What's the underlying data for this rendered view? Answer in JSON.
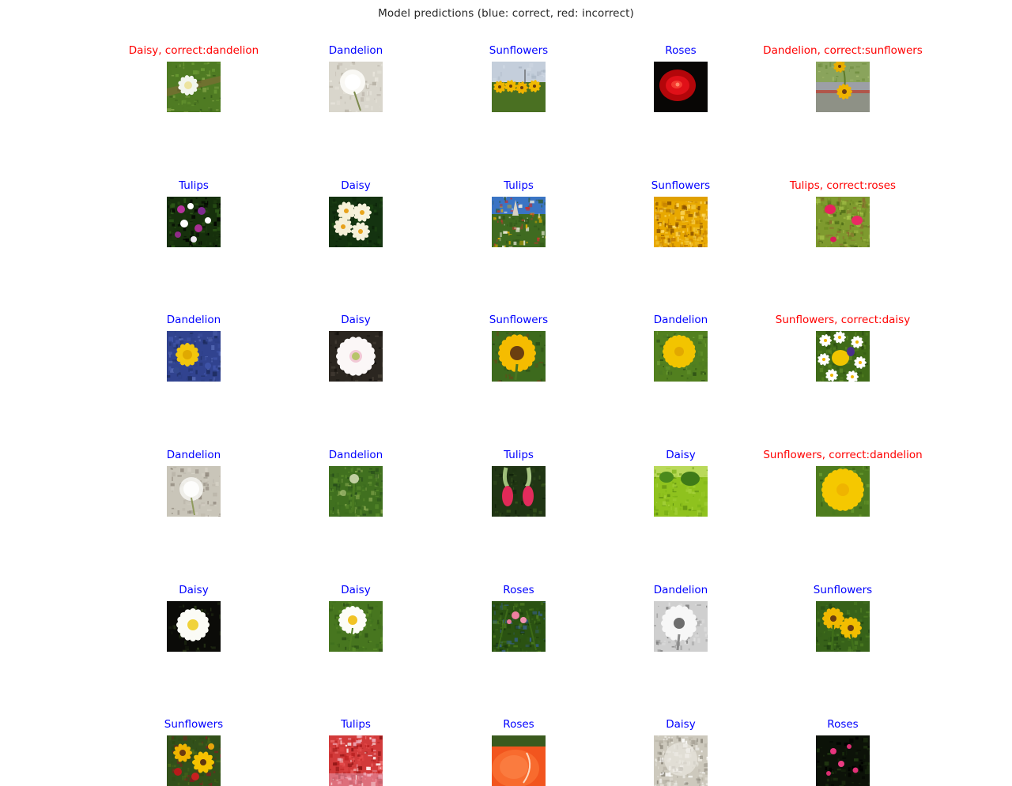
{
  "figure": {
    "title": "Model predictions (blue: correct, red: incorrect)",
    "colors": {
      "correct": "#0000ff",
      "incorrect": "#ff0000",
      "title_color": "#262626",
      "background": "#ffffff"
    },
    "grid": {
      "columns": 5,
      "label_rows": 6,
      "image_rows": 6
    }
  },
  "columns": [
    {
      "index": 0,
      "cells": [
        {
          "label": "Daisy, correct:dandelion",
          "status": "incorrect",
          "predicted": "Daisy",
          "actual": "dandelion",
          "image": "daisy-white-on-green-blur"
        },
        {
          "label": "Tulips",
          "status": "correct",
          "predicted": "Tulips",
          "actual": "tulips",
          "image": "purple-white-flower-cluster"
        },
        {
          "label": "Dandelion",
          "status": "correct",
          "predicted": "Dandelion",
          "actual": "dandelion",
          "image": "yellow-dandelion-in-bluebells"
        },
        {
          "label": "Dandelion",
          "status": "correct",
          "predicted": "Dandelion",
          "actual": "dandelion",
          "image": "dandelion-seedhead-grey"
        },
        {
          "label": "Daisy",
          "status": "correct",
          "predicted": "Daisy",
          "actual": "daisy",
          "image": "white-daisy-dark-background"
        },
        {
          "label": "Sunflowers",
          "status": "correct",
          "predicted": "Sunflowers",
          "actual": "sunflowers",
          "image": "sunflower-bouquet-mixed"
        }
      ]
    },
    {
      "index": 1,
      "cells": [
        {
          "label": "Dandelion",
          "status": "correct",
          "predicted": "Dandelion",
          "actual": "dandelion",
          "image": "dandelion-seedhead-white"
        },
        {
          "label": "Daisy",
          "status": "correct",
          "predicted": "Daisy",
          "actual": "daisy",
          "image": "cream-daisies-cluster"
        },
        {
          "label": "Daisy",
          "status": "correct",
          "predicted": "Daisy",
          "actual": "daisy",
          "image": "pink-white-daisy-closeup"
        },
        {
          "label": "Dandelion",
          "status": "correct",
          "predicted": "Dandelion",
          "actual": "dandelion",
          "image": "green-thistle-plant"
        },
        {
          "label": "Daisy",
          "status": "correct",
          "predicted": "Daisy",
          "actual": "daisy",
          "image": "white-daisy-yellow-center-field"
        },
        {
          "label": "Tulips",
          "status": "correct",
          "predicted": "Tulips",
          "actual": "tulips",
          "image": "red-tulip-field"
        }
      ]
    },
    {
      "index": 2,
      "cells": [
        {
          "label": "Sunflowers",
          "status": "correct",
          "predicted": "Sunflowers",
          "actual": "sunflowers",
          "image": "sunflower-field-horizon"
        },
        {
          "label": "Tulips",
          "status": "correct",
          "predicted": "Tulips",
          "actual": "tulips",
          "image": "mixed-wildflowers-blue-sky"
        },
        {
          "label": "Sunflowers",
          "status": "correct",
          "predicted": "Sunflowers",
          "actual": "sunflowers",
          "image": "single-sunflower-yellow"
        },
        {
          "label": "Tulips",
          "status": "correct",
          "predicted": "Tulips",
          "actual": "tulips",
          "image": "two-pink-tulips-hanging"
        },
        {
          "label": "Roses",
          "status": "correct",
          "predicted": "Roses",
          "actual": "roses",
          "image": "pink-roses-foliage"
        },
        {
          "label": "Roses",
          "status": "correct",
          "predicted": "Roses",
          "actual": "roses",
          "image": "orange-rose-closeup"
        }
      ]
    },
    {
      "index": 3,
      "cells": [
        {
          "label": "Roses",
          "status": "correct",
          "predicted": "Roses",
          "actual": "roses",
          "image": "red-rose-black-background"
        },
        {
          "label": "Sunflowers",
          "status": "correct",
          "predicted": "Sunflowers",
          "actual": "sunflowers",
          "image": "sunflower-center-macro"
        },
        {
          "label": "Dandelion",
          "status": "correct",
          "predicted": "Dandelion",
          "actual": "dandelion",
          "image": "yellow-dandelion-macro"
        },
        {
          "label": "Daisy",
          "status": "correct",
          "predicted": "Daisy",
          "actual": "daisy",
          "image": "green-meadow-tree"
        },
        {
          "label": "Dandelion",
          "status": "correct",
          "predicted": "Dandelion",
          "actual": "dandelion",
          "image": "black-white-daisy"
        },
        {
          "label": "Daisy",
          "status": "correct",
          "predicted": "Daisy",
          "actual": "daisy",
          "image": "dandelion-seedhead-grey-macro"
        }
      ]
    },
    {
      "index": 4,
      "cells": [
        {
          "label": "Dandelion, correct:sunflowers",
          "status": "incorrect",
          "predicted": "Dandelion",
          "actual": "sunflowers",
          "image": "sunflower-roadside-pole"
        },
        {
          "label": "Tulips, correct:roses",
          "status": "incorrect",
          "predicted": "Tulips",
          "actual": "roses",
          "image": "pink-roses-moss-ground"
        },
        {
          "label": "Sunflowers, correct:daisy",
          "status": "incorrect",
          "predicted": "Sunflowers",
          "actual": "daisy",
          "image": "white-daisies-yellow-pansy"
        },
        {
          "label": "Sunflowers, correct:dandelion",
          "status": "incorrect",
          "predicted": "Sunflowers",
          "actual": "dandelion",
          "image": "yellow-dandelion-bloom-large"
        },
        {
          "label": "Sunflowers",
          "status": "correct",
          "predicted": "Sunflowers",
          "actual": "sunflowers",
          "image": "sunflowers-two-green-stems"
        },
        {
          "label": "Roses",
          "status": "correct",
          "predicted": "Roses",
          "actual": "roses",
          "image": "pink-roses-dark-night"
        }
      ]
    }
  ]
}
